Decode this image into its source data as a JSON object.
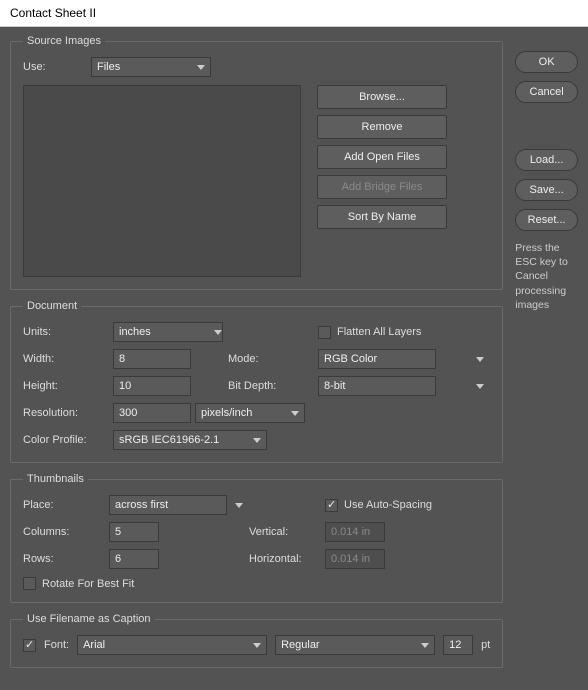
{
  "title": "Contact Sheet II",
  "right": {
    "ok": "OK",
    "cancel": "Cancel",
    "load": "Load...",
    "save": "Save...",
    "reset": "Reset...",
    "hint": "Press the ESC key to Cancel processing images"
  },
  "source": {
    "legend": "Source Images",
    "use_label": "Use:",
    "use_value": "Files",
    "browse": "Browse...",
    "remove": "Remove",
    "add_open": "Add Open Files",
    "add_bridge": "Add Bridge Files",
    "sort": "Sort By Name"
  },
  "document": {
    "legend": "Document",
    "units_label": "Units:",
    "units_value": "inches",
    "flatten": "Flatten All Layers",
    "width_label": "Width:",
    "width_value": "8",
    "mode_label": "Mode:",
    "mode_value": "RGB Color",
    "height_label": "Height:",
    "height_value": "10",
    "bitdepth_label": "Bit Depth:",
    "bitdepth_value": "8-bit",
    "res_label": "Resolution:",
    "res_value": "300",
    "res_units": "pixels/inch",
    "profile_label": "Color Profile:",
    "profile_value": "sRGB IEC61966-2.1"
  },
  "thumbs": {
    "legend": "Thumbnails",
    "place_label": "Place:",
    "place_value": "across first",
    "auto": "Use Auto-Spacing",
    "cols_label": "Columns:",
    "cols_value": "5",
    "vert_label": "Vertical:",
    "vert_value": "0.014 in",
    "rows_label": "Rows:",
    "rows_value": "6",
    "horz_label": "Horizontal:",
    "horz_value": "0.014 in",
    "rotate": "Rotate For Best Fit"
  },
  "caption": {
    "legend": "Use Filename as Caption",
    "font_label": "Font:",
    "font_value": "Arial",
    "style_value": "Regular",
    "size_value": "12",
    "size_unit": "pt"
  }
}
